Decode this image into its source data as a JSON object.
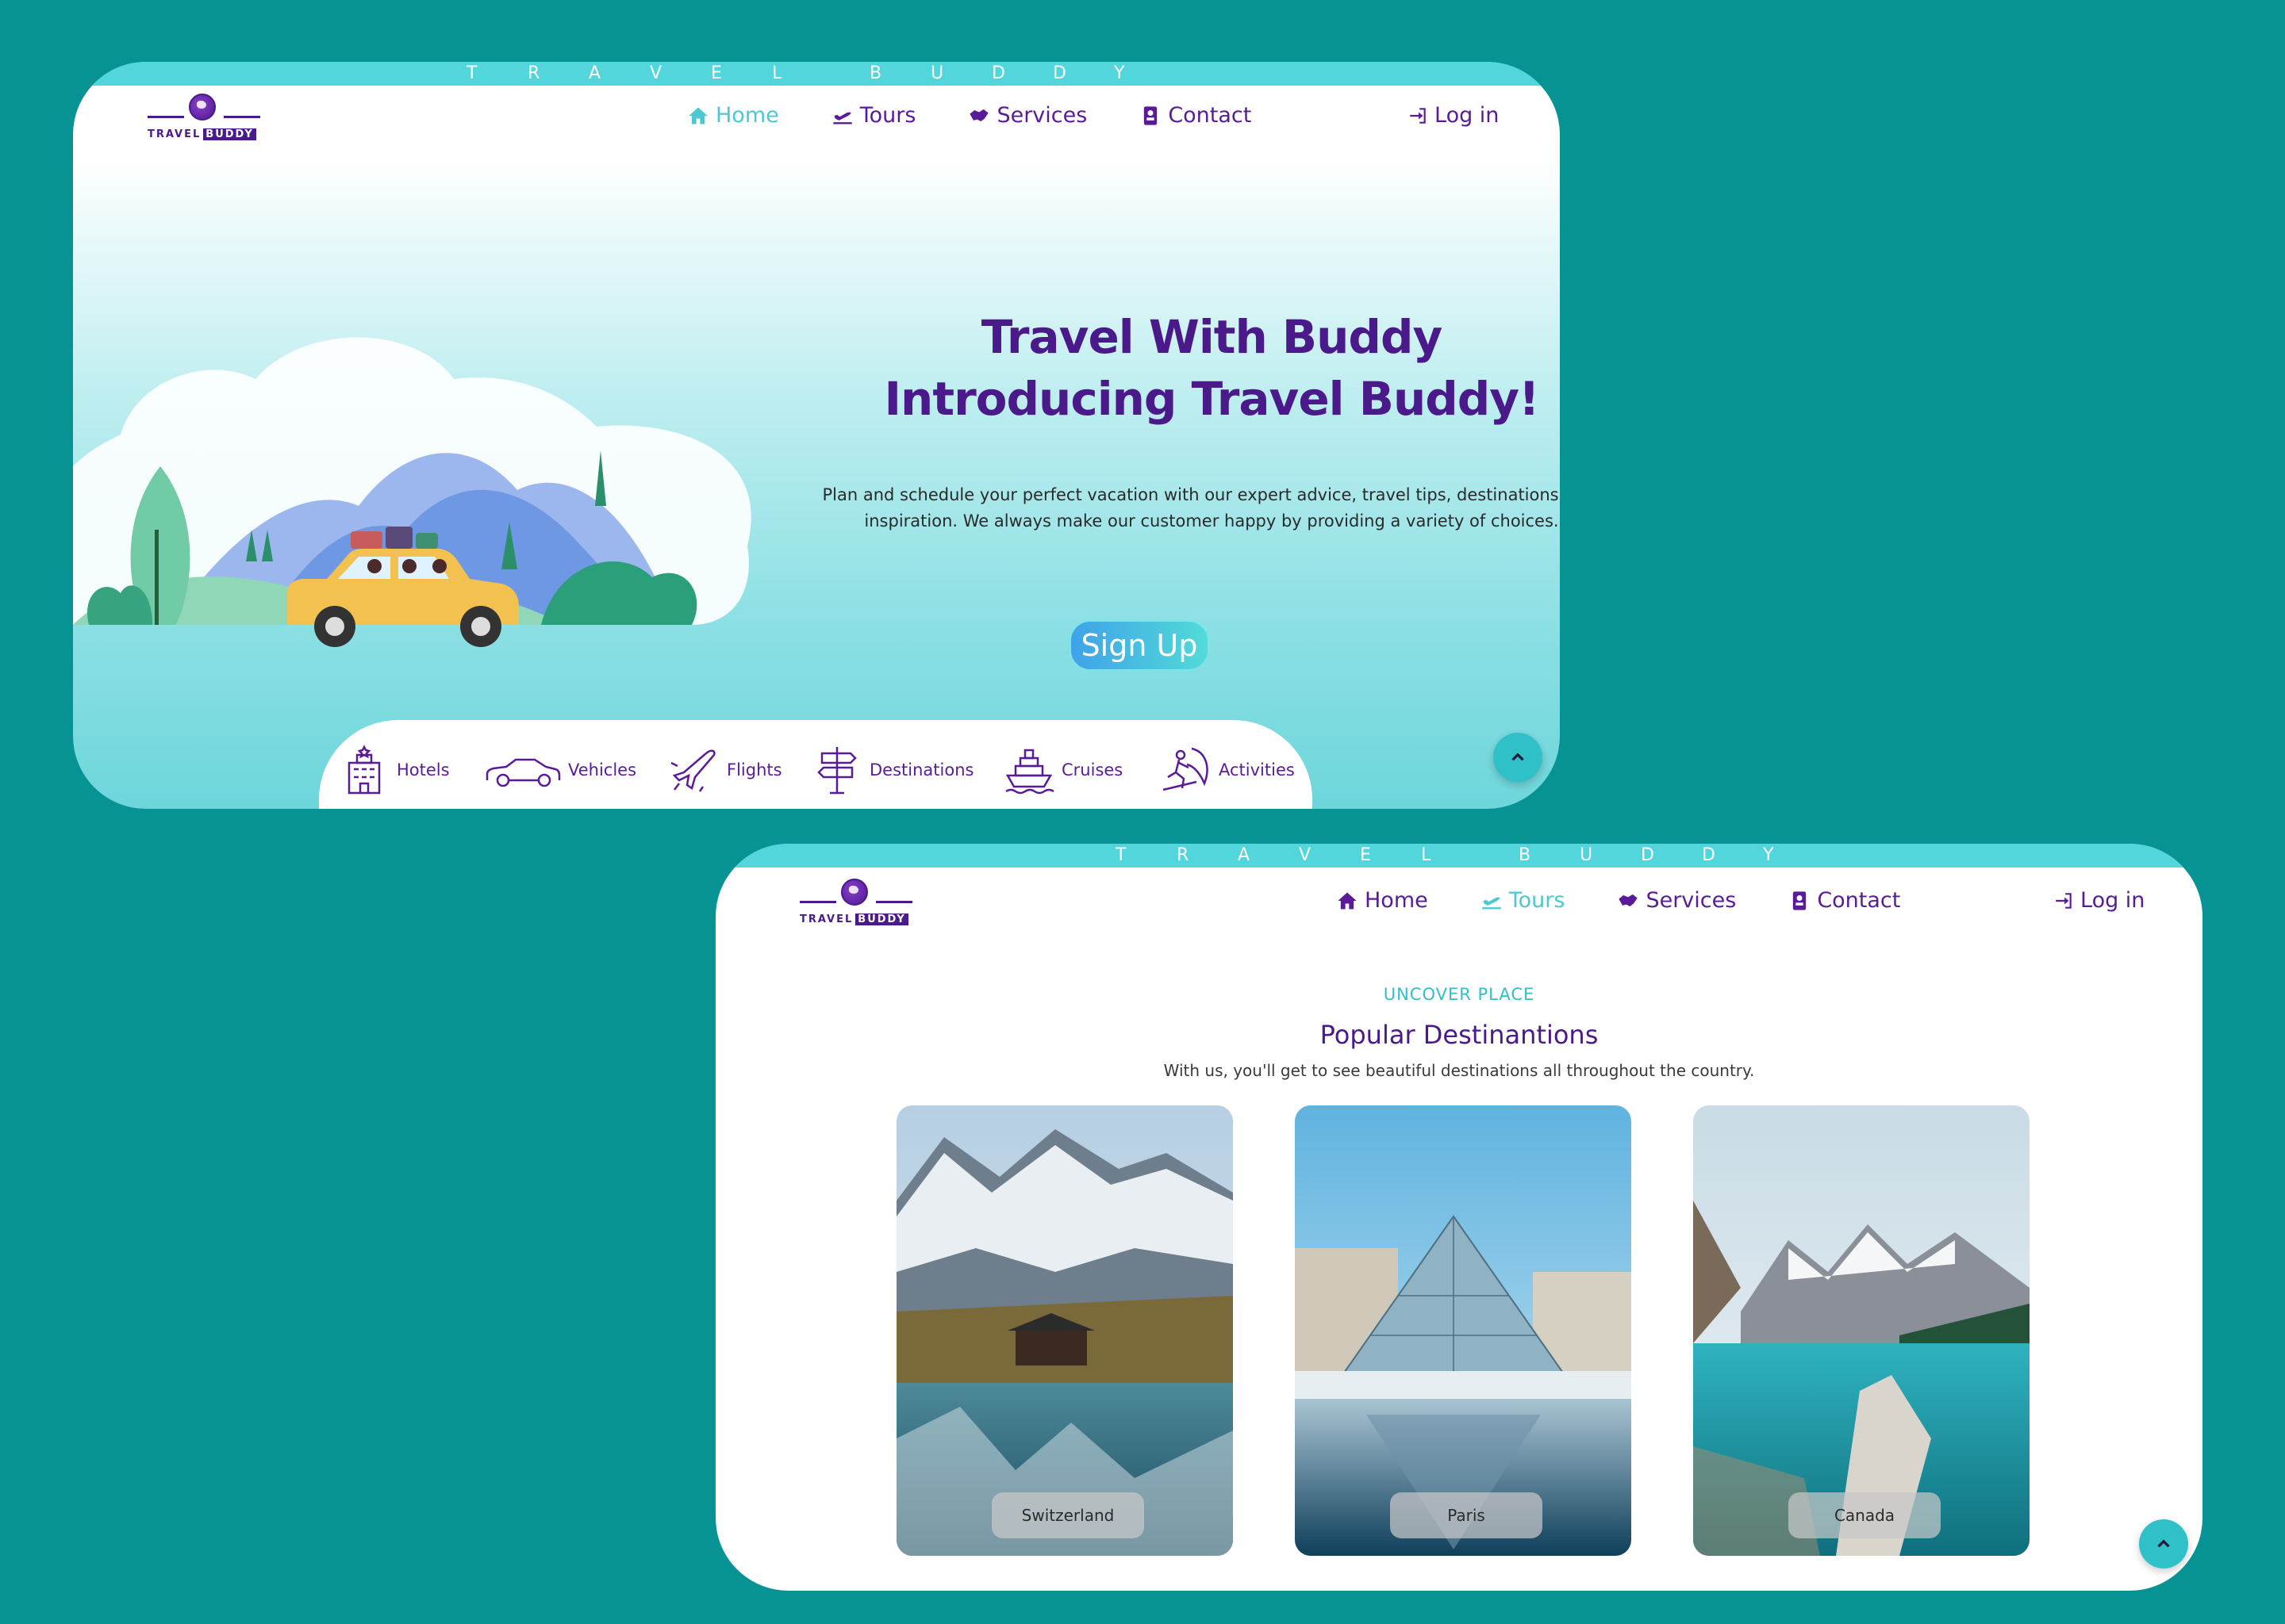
{
  "brand": {
    "banner_text": "TRAVEL BUDDY",
    "logo_word_1": "TRAVEL",
    "logo_word_2": "BUDDY"
  },
  "nav": {
    "home": "Home",
    "tours": "Tours",
    "services": "Services",
    "contact": "Contact",
    "login": "Log in"
  },
  "home_screen": {
    "active_nav": "home",
    "hero_title_line_1": "Travel With Buddy",
    "hero_title_line_2": "Introducing Travel Buddy!",
    "hero_description": "Plan and schedule your perfect vacation with our expert advice, travel tips, destinations, and inspiration. We always make our customer happy by providing a variety of choices.",
    "signup_label": "Sign Up",
    "services": [
      {
        "label": "Hotels",
        "icon": "hotel-icon"
      },
      {
        "label": "Vehicles",
        "icon": "car-icon"
      },
      {
        "label": "Flights",
        "icon": "airplane-icon"
      },
      {
        "label": "Destinations",
        "icon": "signpost-icon"
      },
      {
        "label": "Cruises",
        "icon": "ship-icon"
      },
      {
        "label": "Activities",
        "icon": "surfing-icon"
      }
    ]
  },
  "tours_screen": {
    "active_nav": "tours",
    "eyebrow": "UNCOVER PLACE",
    "title": "Popular Destinantions",
    "subtitle": "With us, you'll get to see beautiful destinations all throughout the country.",
    "destinations": [
      {
        "label": "Switzerland"
      },
      {
        "label": "Paris"
      },
      {
        "label": "Canada"
      }
    ]
  },
  "colors": {
    "background": "#079294",
    "accent_teal": "#52d6dc",
    "brand_purple": "#4b1a8a",
    "active_nav": "#4cc8d0"
  }
}
